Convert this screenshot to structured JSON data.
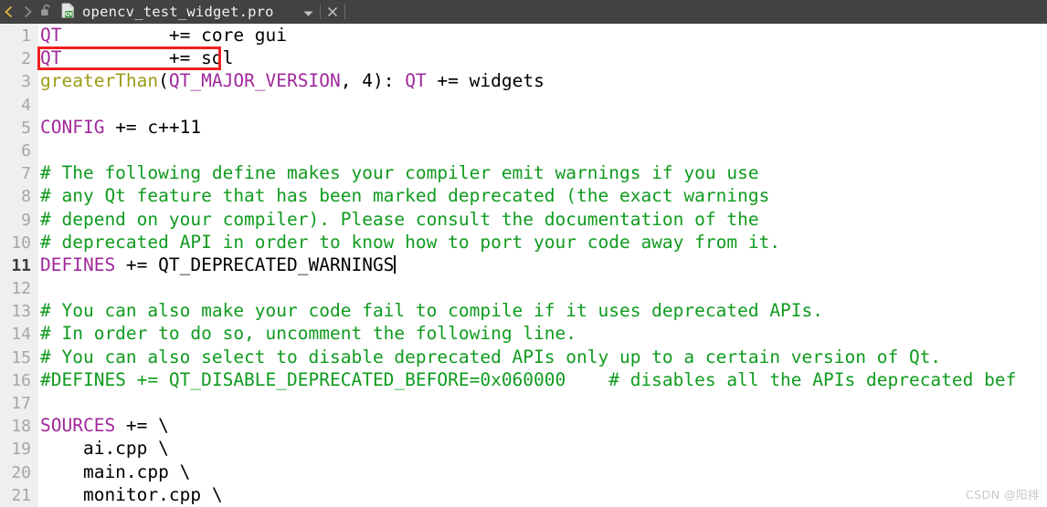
{
  "titlebar": {
    "back_icon": "chevron-left-icon",
    "forward_icon": "chevron-right-icon",
    "lock_icon": "unlocked-padlock-icon",
    "file_icon": "qt-project-file-icon",
    "file_icon_badge": "Qt",
    "title": "opencv_test_widget.pro",
    "dropdown_icon": "chevron-down-icon",
    "close_icon": "close-icon",
    "close_label": "×"
  },
  "editor": {
    "language": "qmake",
    "current_line": 11,
    "cursor_line": 11,
    "lines": [
      {
        "n": "1",
        "tokens": [
          {
            "t": "QT",
            "c": "kw"
          },
          {
            "t": "          += core gui",
            "c": "pl"
          }
        ]
      },
      {
        "n": "2",
        "tokens": [
          {
            "t": "QT",
            "c": "kw"
          },
          {
            "t": "          += sql",
            "c": "pl"
          }
        ]
      },
      {
        "n": "3",
        "tokens": [
          {
            "t": "greaterThan",
            "c": "fn"
          },
          {
            "t": "(",
            "c": "pl"
          },
          {
            "t": "QT_MAJOR_VERSION",
            "c": "kw"
          },
          {
            "t": ", 4): ",
            "c": "pl"
          },
          {
            "t": "QT",
            "c": "kw"
          },
          {
            "t": " += widgets",
            "c": "pl"
          }
        ]
      },
      {
        "n": "4",
        "tokens": []
      },
      {
        "n": "5",
        "tokens": [
          {
            "t": "CONFIG",
            "c": "kw"
          },
          {
            "t": " += c++11",
            "c": "pl"
          }
        ]
      },
      {
        "n": "6",
        "tokens": []
      },
      {
        "n": "7",
        "tokens": [
          {
            "t": "# The following define makes your compiler emit warnings if you use",
            "c": "cm"
          }
        ]
      },
      {
        "n": "8",
        "tokens": [
          {
            "t": "# any Qt feature that has been marked deprecated (the exact warnings",
            "c": "cm"
          }
        ]
      },
      {
        "n": "9",
        "tokens": [
          {
            "t": "# depend on your compiler). Please consult the documentation of the",
            "c": "cm"
          }
        ]
      },
      {
        "n": "10",
        "tokens": [
          {
            "t": "# deprecated API in order to know how to port your code away from it.",
            "c": "cm"
          }
        ]
      },
      {
        "n": "11",
        "tokens": [
          {
            "t": "DEFINES",
            "c": "kw"
          },
          {
            "t": " += QT_DEPRECATED_WARNINGS",
            "c": "pl"
          }
        ],
        "caret": true
      },
      {
        "n": "12",
        "tokens": []
      },
      {
        "n": "13",
        "tokens": [
          {
            "t": "# You can also make your code fail to compile if it uses deprecated APIs.",
            "c": "cm"
          }
        ]
      },
      {
        "n": "14",
        "tokens": [
          {
            "t": "# In order to do so, uncomment the following line.",
            "c": "cm"
          }
        ]
      },
      {
        "n": "15",
        "tokens": [
          {
            "t": "# You can also select to disable deprecated APIs only up to a certain version of Qt.",
            "c": "cm"
          }
        ]
      },
      {
        "n": "16",
        "tokens": [
          {
            "t": "#DEFINES += QT_DISABLE_DEPRECATED_BEFORE=0x060000    # disables all the APIs deprecated bef",
            "c": "cm"
          }
        ]
      },
      {
        "n": "17",
        "tokens": []
      },
      {
        "n": "18",
        "tokens": [
          {
            "t": "SOURCES",
            "c": "kw"
          },
          {
            "t": " += \\",
            "c": "pl"
          }
        ]
      },
      {
        "n": "19",
        "tokens": [
          {
            "t": "    ai.cpp \\",
            "c": "pl"
          }
        ]
      },
      {
        "n": "20",
        "tokens": [
          {
            "t": "    main.cpp \\",
            "c": "pl"
          }
        ]
      },
      {
        "n": "21",
        "tokens": [
          {
            "t": "    monitor.cpp \\",
            "c": "pl"
          }
        ]
      }
    ]
  },
  "annotation": {
    "shape": "rectangle",
    "color": "#f02020",
    "targets_line": "2",
    "targets_text": "QT          += sql"
  },
  "watermark": {
    "text": "CSDN @阳排"
  },
  "colors": {
    "titlebar_bg": "#424242",
    "gutter_bg": "#efefef",
    "editor_bg": "#ffffff",
    "keyword": "#a0289b",
    "function": "#9c9c18",
    "comment": "#0f9b1e",
    "plain": "#000000",
    "annotation": "#f02020"
  }
}
